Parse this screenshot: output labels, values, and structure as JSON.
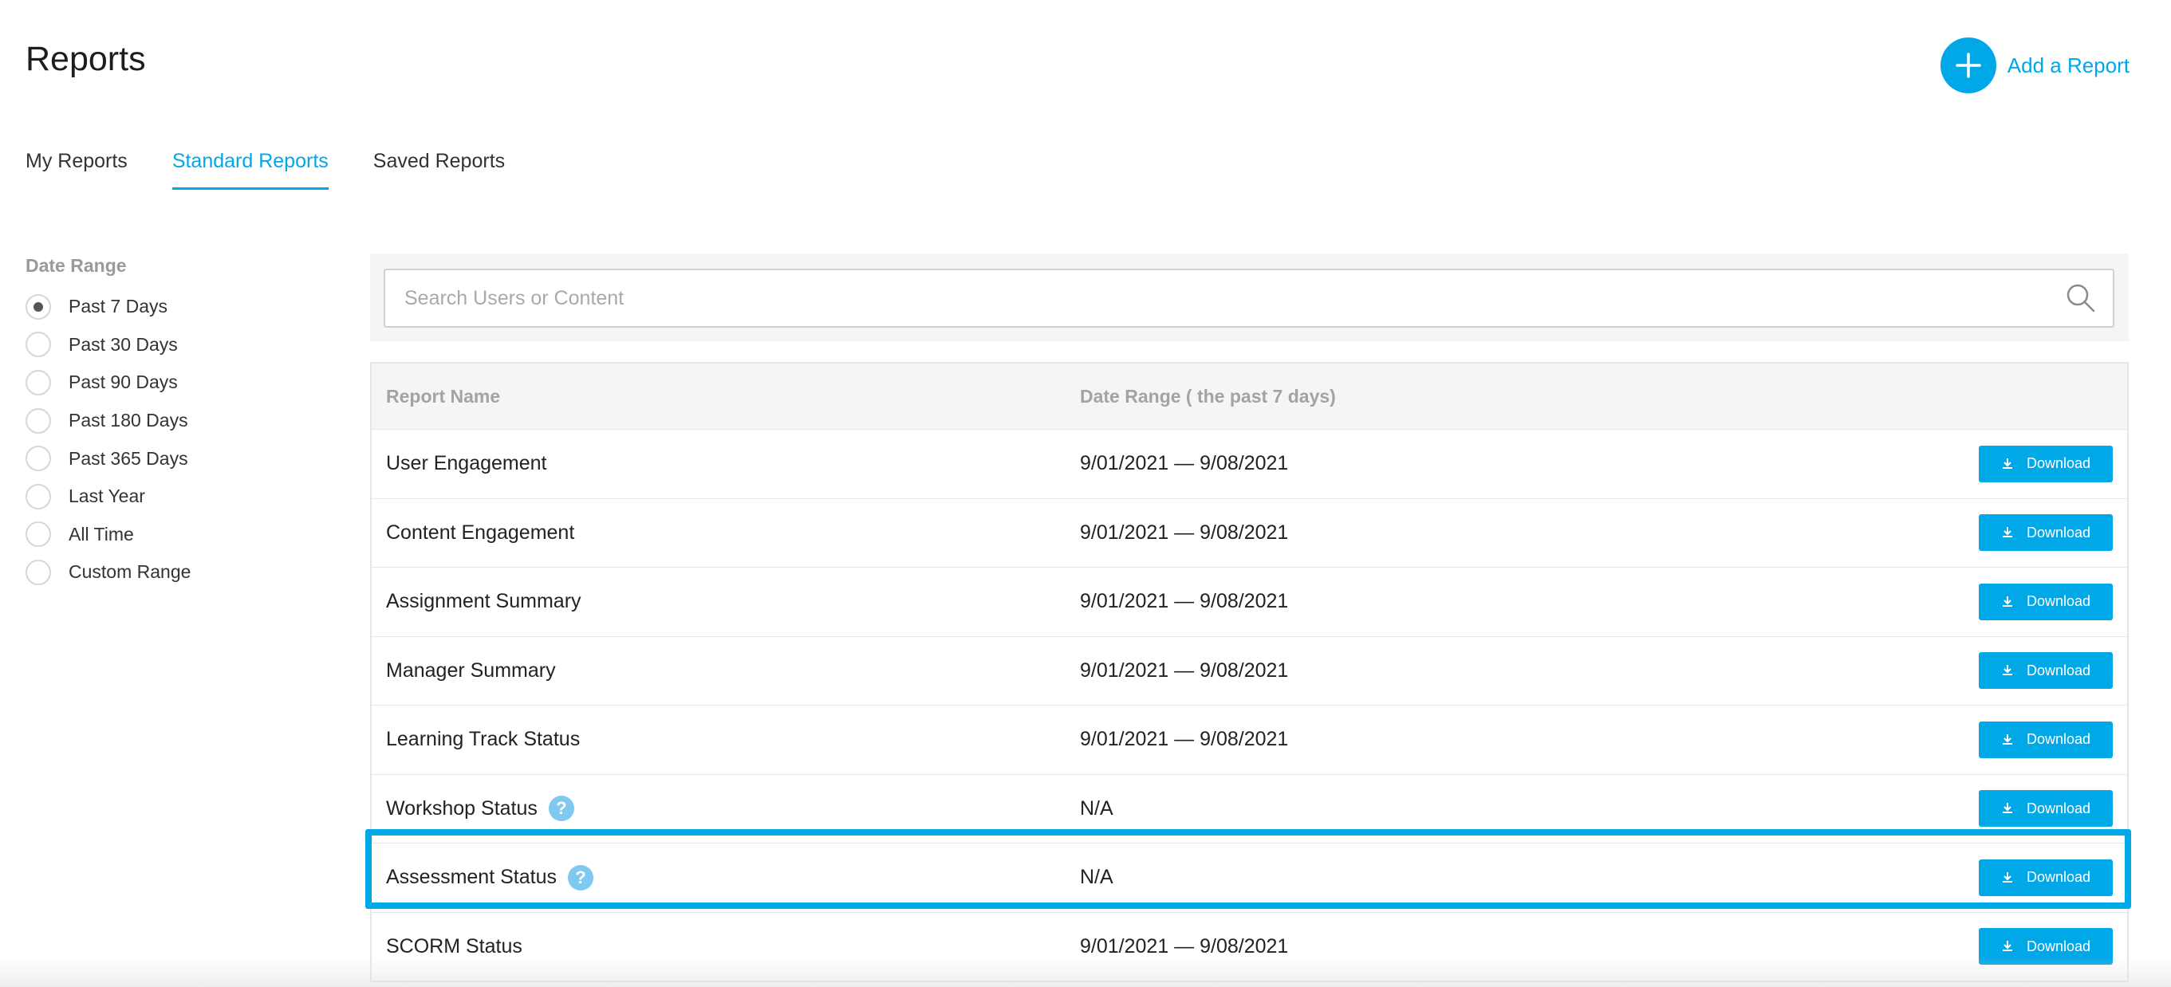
{
  "page": {
    "title": "Reports"
  },
  "add_report": {
    "label": "Add a Report",
    "icon": "plus-icon",
    "color": "#00a8e8"
  },
  "tabs": [
    {
      "label": "My Reports",
      "active": false
    },
    {
      "label": "Standard Reports",
      "active": true
    },
    {
      "label": "Saved Reports",
      "active": false
    }
  ],
  "filter": {
    "title": "Date Range",
    "options": [
      {
        "label": "Past 7 Days",
        "selected": true
      },
      {
        "label": "Past 30 Days",
        "selected": false
      },
      {
        "label": "Past 90 Days",
        "selected": false
      },
      {
        "label": "Past 180 Days",
        "selected": false
      },
      {
        "label": "Past 365 Days",
        "selected": false
      },
      {
        "label": "Last Year",
        "selected": false
      },
      {
        "label": "All Time",
        "selected": false
      },
      {
        "label": "Custom Range",
        "selected": false
      }
    ]
  },
  "search": {
    "placeholder": "Search Users or Content",
    "value": "",
    "icon": "search-icon"
  },
  "table": {
    "headers": {
      "name": "Report Name",
      "range": "Date Range ( the past 7 days)"
    },
    "download_label": "Download",
    "rows": [
      {
        "name": "User Engagement",
        "range": "9/01/2021 — 9/08/2021",
        "help": false
      },
      {
        "name": "Content Engagement",
        "range": "9/01/2021 — 9/08/2021",
        "help": false
      },
      {
        "name": "Assignment Summary",
        "range": "9/01/2021 — 9/08/2021",
        "help": false
      },
      {
        "name": "Manager Summary",
        "range": "9/01/2021 — 9/08/2021",
        "help": false
      },
      {
        "name": "Learning Track Status",
        "range": "9/01/2021 — 9/08/2021",
        "help": false
      },
      {
        "name": "Workshop Status",
        "range": "N/A",
        "help": true
      },
      {
        "name": "Assessment Status",
        "range": "N/A",
        "help": true
      },
      {
        "name": "SCORM Status",
        "range": "9/01/2021 — 9/08/2021",
        "help": false
      }
    ],
    "highlighted_row": "Assessment Status"
  },
  "colors": {
    "accent": "#00a8e8",
    "help_badge": "#7ec8f2"
  }
}
